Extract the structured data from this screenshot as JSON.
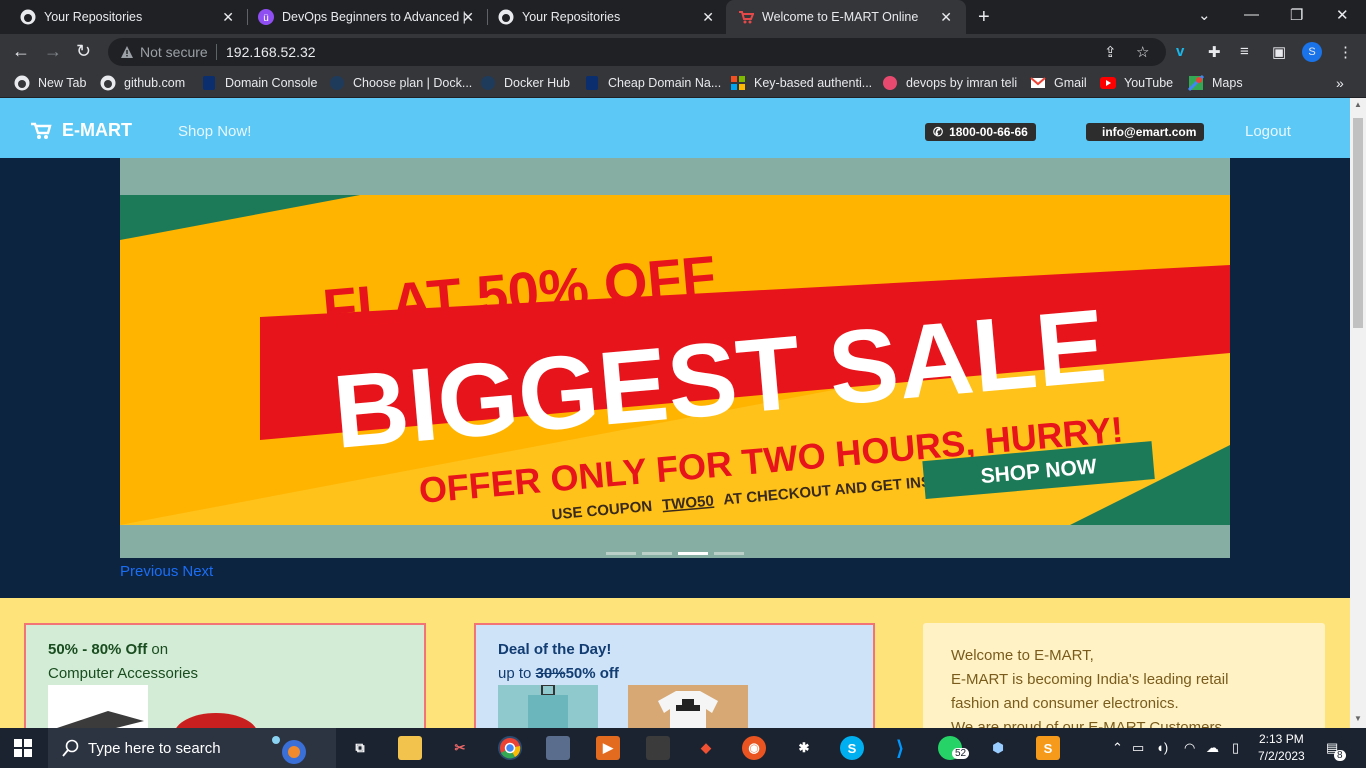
{
  "tabs": [
    {
      "title": "Your Repositories",
      "icon": "github-icon"
    },
    {
      "title": "DevOps Beginners to Advanced |",
      "icon": "udemy-icon"
    },
    {
      "title": "Your Repositories",
      "icon": "github-icon"
    },
    {
      "title": "Welcome to E-MART Online",
      "icon": "cart-icon",
      "active": true
    }
  ],
  "toolbar": {
    "security_label": "Not secure",
    "url": "192.168.52.32",
    "profile_initial": "S"
  },
  "bookmarks": [
    {
      "label": "New Tab",
      "icon": "github-icon"
    },
    {
      "label": "github.com",
      "icon": "github-icon"
    },
    {
      "label": "Domain Console",
      "icon": "domain-icon"
    },
    {
      "label": "Choose plan | Dock...",
      "icon": "docker-icon"
    },
    {
      "label": "Docker Hub",
      "icon": "docker-icon"
    },
    {
      "label": "Cheap Domain Na...",
      "icon": "domain-icon"
    },
    {
      "label": "Key-based authenti...",
      "icon": "microsoft-icon"
    },
    {
      "label": "devops by imran teli",
      "icon": "devops-icon"
    },
    {
      "label": "Gmail",
      "icon": "gmail-icon"
    },
    {
      "label": "YouTube",
      "icon": "youtube-icon"
    },
    {
      "label": "Maps",
      "icon": "maps-icon"
    }
  ],
  "site": {
    "brand": "E-MART",
    "nav_shop": "Shop Now!",
    "phone": "1800-00-66-66",
    "email": "info@emart.com",
    "logout": "Logout",
    "banner": {
      "line1": "FLAT 50% OFF",
      "line2": "BIGGEST SALE",
      "line3": "OFFER ONLY FOR TWO HOURS, HURRY!",
      "line4_prefix": "USE COUPON",
      "coupon": "TWO50",
      "line4_suffix": "AT CHECKOUT AND GET INSTANT DISCOUNT",
      "cta": "SHOP NOW"
    },
    "carousel_active_index": 3,
    "carousel_count": 4,
    "prev": "Previous",
    "next": "Next",
    "card1": {
      "highlight": "50% - 80% Off",
      "tail": "on",
      "line2": "Computer Accessories"
    },
    "card2": {
      "title": "Deal of the Day!",
      "prefix": "up to",
      "old": "30%",
      "new": "50% off"
    },
    "card3": {
      "line1": "Welcome to E-MART,",
      "line2": "E-MART is becoming India's leading retail",
      "line3": "fashion and consumer electronics.",
      "line4": "We are proud of our E-MART Customers"
    }
  },
  "taskbar": {
    "search_placeholder": "Type here to search",
    "time": "2:13 PM",
    "date": "7/2/2023",
    "whatsapp_badge": "52",
    "notification_count": "8"
  },
  "colors": {
    "navbar": "#5bc8f5",
    "page_bg": "#0d2440",
    "accent_yellow": "#fde37a",
    "banner_red": "#e8141b",
    "banner_yellow": "#ffc21a"
  }
}
